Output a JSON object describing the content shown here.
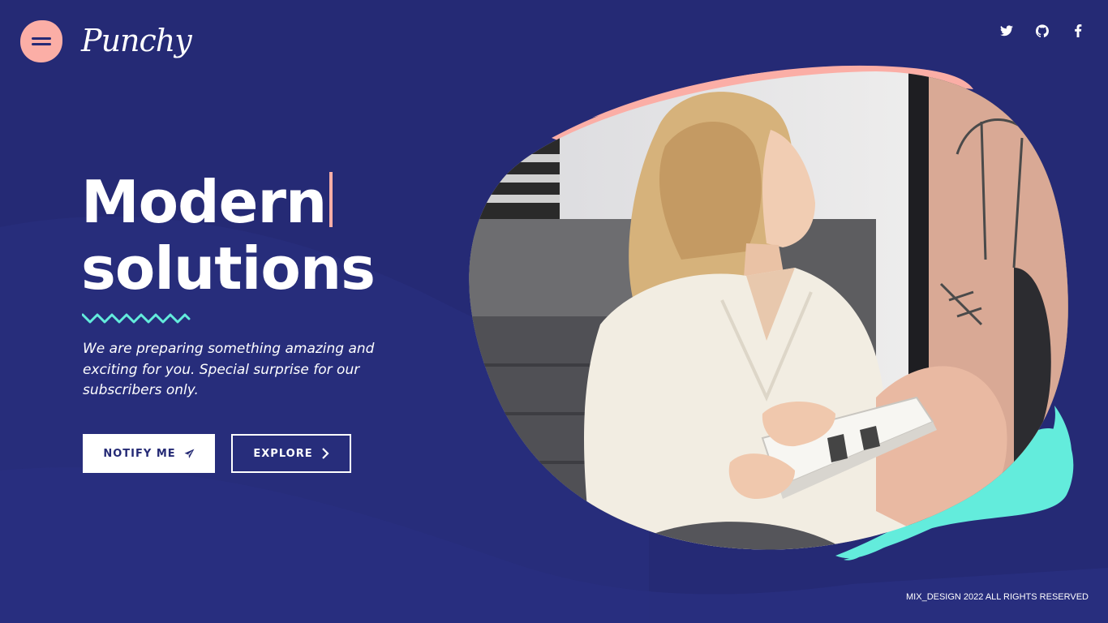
{
  "brand": {
    "name": "Punchy",
    "colors": {
      "background": "#252a75",
      "accent_pink": "#fbaea6",
      "accent_teal": "#63ecdc"
    }
  },
  "header": {
    "menu_icon": "hamburger-menu-icon",
    "social": [
      {
        "icon": "twitter-icon",
        "label": "Twitter"
      },
      {
        "icon": "github-icon",
        "label": "GitHub"
      },
      {
        "icon": "facebook-icon",
        "label": "Facebook"
      }
    ]
  },
  "hero": {
    "title_line1": "Modern",
    "title_line2": "solutions",
    "description": "We are preparing something amazing and exciting for you. Special surprise for our subscribers only.",
    "notify_label": "NOTIFY ME",
    "notify_icon": "paper-plane-icon",
    "explore_label": "EXPLORE",
    "explore_icon": "chevron-right-icon",
    "image_alt": "Woman in white coat reading a magazine"
  },
  "footer": {
    "copyright": "MIX_DESIGN 2022 ALL RIGHTS RESERVED"
  }
}
